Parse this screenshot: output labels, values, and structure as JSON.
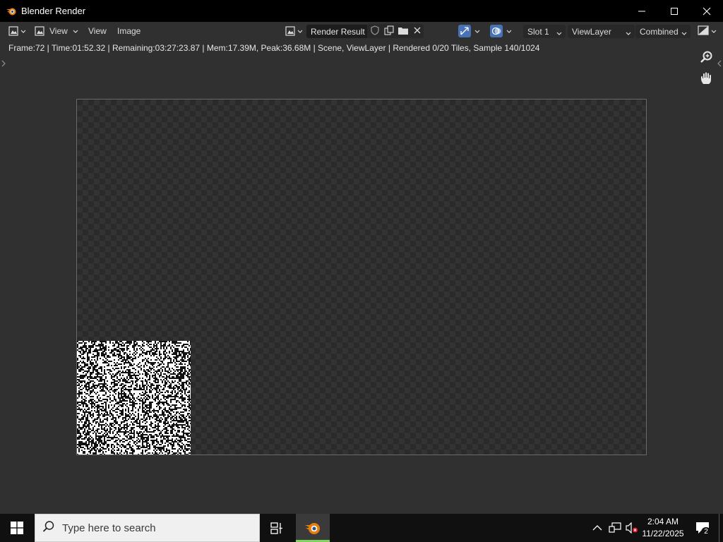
{
  "window": {
    "title": "Blender Render",
    "controls": [
      "minimize-icon",
      "maximize-icon",
      "close-icon"
    ]
  },
  "header": {
    "editor_type_icon": "image-editor-icon",
    "view_menu_label": "View",
    "menus": [
      "View",
      "Image"
    ],
    "image_name": "Render Result",
    "image_buttons": [
      "fake-user-shield-icon",
      "new-image-icon",
      "open-folder-icon",
      "unlink-x-icon"
    ],
    "slot": "Slot 1",
    "view_layer": "ViewLayer",
    "render_pass": "Combined",
    "display_channels_icon": "display-channels-icon"
  },
  "info": {
    "text": "Frame:72 | Time:01:52.32 | Remaining:03:27:23.87 | Mem:17.39M, Peak:36.68M | Scene, ViewLayer | Rendered 0/20 Tiles, Sample 140/1024"
  },
  "render": {
    "tiles_rendered": 0,
    "tiles_total": 20,
    "sample_current": 140,
    "sample_total": 1024
  },
  "taskbar": {
    "search_placeholder": "Type here to search",
    "clock_time": "2:04 AM",
    "clock_date": "11/22/2025",
    "notification_count": "2"
  },
  "colors": {
    "titlebar": "#000000",
    "editor_bg": "#303030",
    "taskbar": "#101010",
    "active_app_accent": "#7fd45b",
    "blender_orange": "#e87d0d",
    "toggle_blue": "#4772b3"
  }
}
